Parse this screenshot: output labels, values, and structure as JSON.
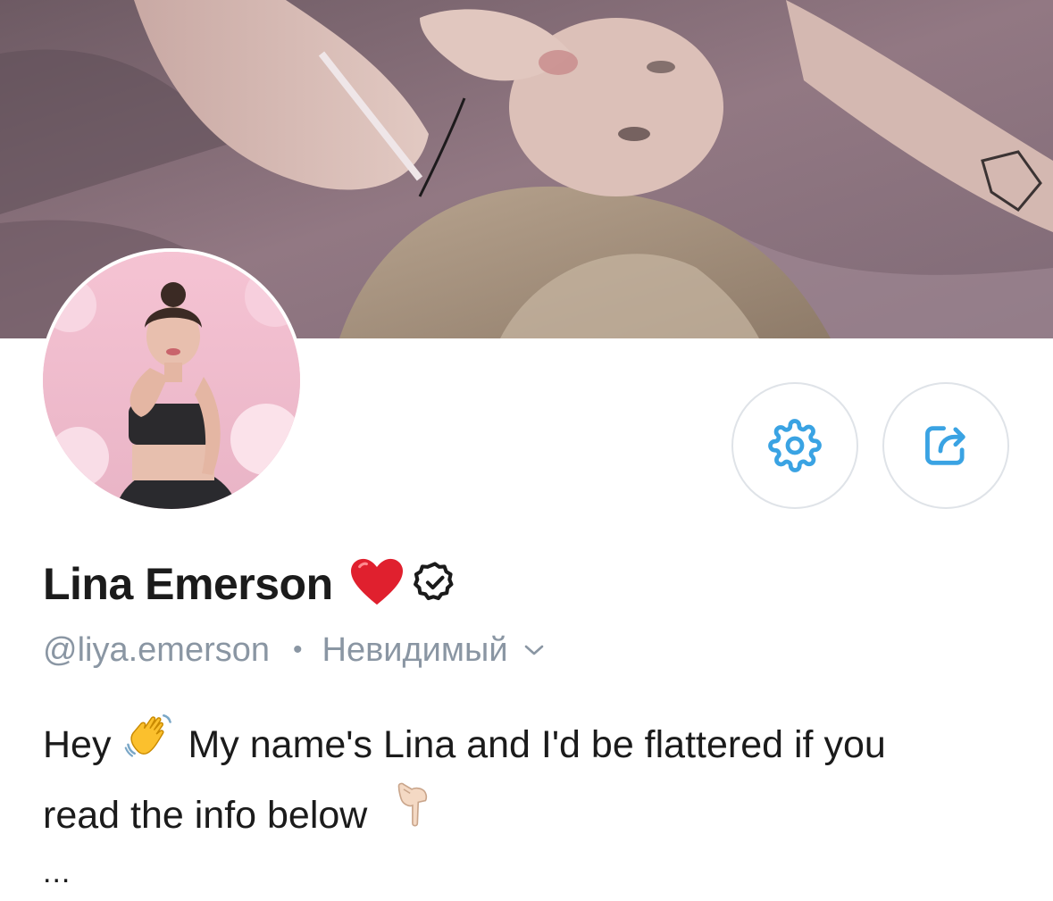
{
  "profile": {
    "display_name": "Lina Emerson",
    "name_emoji": "heart-emoji",
    "verified_icon": "verified-badge-icon",
    "handle": "@liya.emerson",
    "separator": "•",
    "status": "Невидимый",
    "status_icon": "chevron-down-icon"
  },
  "bio": {
    "line1_start": "Hey",
    "line1_emoji": "waving-hand-emoji",
    "line1_end": "My name's Lina and I'd be flattered if you",
    "line2_start": "read the info below",
    "line2_emoji": "pointing-down-emoji",
    "more": "..."
  },
  "actions": {
    "settings_icon": "gear-icon",
    "share_icon": "share-icon"
  },
  "colors": {
    "accent": "#3aa3e3",
    "muted_text": "#8a96a3",
    "primary_text": "#1b1b1b",
    "heart": "#e0202e",
    "button_border": "#dfe3e8"
  }
}
